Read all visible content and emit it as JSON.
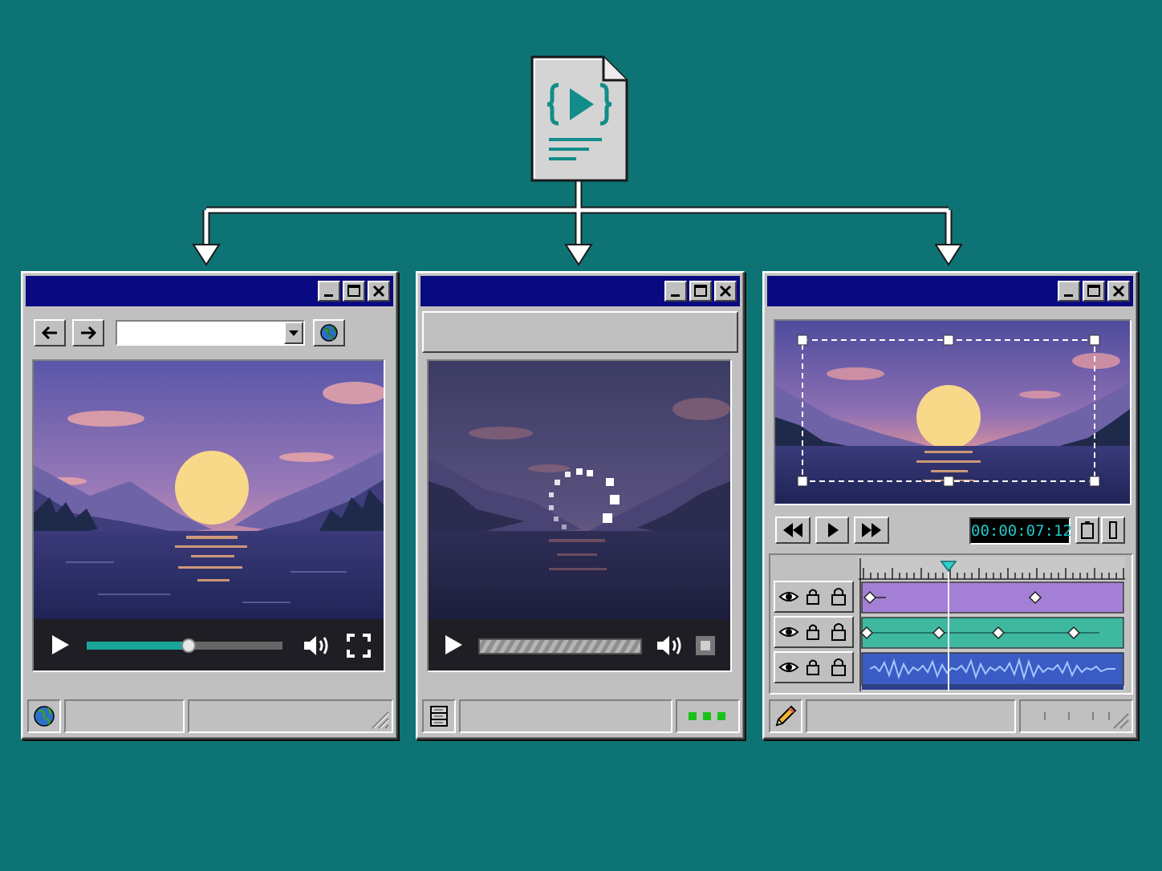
{
  "editor": {
    "timecode": "00:00:07:12"
  },
  "colors": {
    "desktop": "#0e7374",
    "title_bar": "#0a0a80",
    "window_face": "#c0c0c0",
    "accent_teal": "#1aa59a",
    "track_purple": "#a37fd6",
    "track_teal": "#3fb8a0",
    "track_audio": "#3a5cc4",
    "playhead": "#2fd0d0",
    "status_led": "#19c219"
  },
  "player": {
    "progress": 0.52
  },
  "icons": [
    "code-play-file-icon",
    "back-arrow-icon",
    "forward-arrow-icon",
    "dropdown-arrow-icon",
    "globe-icon",
    "play-icon",
    "volume-icon",
    "fullscreen-icon",
    "server-icon",
    "stop-icon",
    "rewind-icon",
    "fast-forward-icon",
    "eye-icon",
    "lock-icon",
    "pencil-icon",
    "resize-grip-icon"
  ]
}
